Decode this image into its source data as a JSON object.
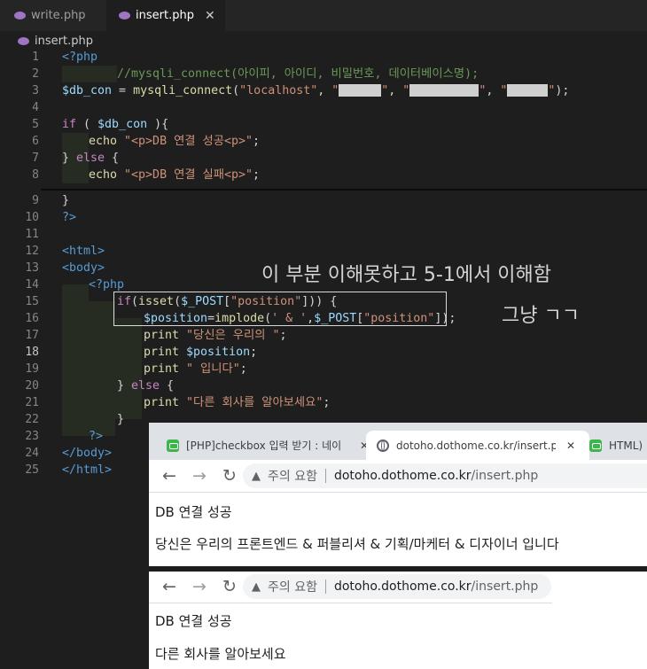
{
  "editor": {
    "tabs": [
      {
        "label": "write.php"
      },
      {
        "label": "insert.php"
      }
    ],
    "close_glyph": "✕",
    "breadcrumb": "insert.php",
    "file_icon": "php-elephant-icon",
    "lines": [
      {
        "n": "1"
      },
      {
        "n": "2"
      },
      {
        "n": "3"
      },
      {
        "n": "4"
      },
      {
        "n": "5"
      },
      {
        "n": "6"
      },
      {
        "n": "7"
      },
      {
        "n": "8"
      },
      {
        "n": "9"
      },
      {
        "n": "10"
      },
      {
        "n": "11"
      },
      {
        "n": "12"
      },
      {
        "n": "13"
      },
      {
        "n": "14"
      },
      {
        "n": "15"
      },
      {
        "n": "16"
      },
      {
        "n": "17"
      },
      {
        "n": "18"
      },
      {
        "n": "19"
      },
      {
        "n": "20"
      },
      {
        "n": "21"
      },
      {
        "n": "22"
      },
      {
        "n": "23"
      },
      {
        "n": "24"
      },
      {
        "n": "25"
      }
    ],
    "code": {
      "l1": "<?php",
      "l2": "//mysqli_connect(아이피, 아이디, 비밀번호, 데이터베이스명);",
      "l3_var": "$db_con",
      "l3_eq": " = ",
      "l3_fn": "mysqli_connect",
      "l3_open": "(",
      "l3_s1": "\"localhost\"",
      "l3_comma1": ", ",
      "l3_s2a": "\"",
      "l3_s2b": "\"",
      "l3_comma2": ", ",
      "l3_s3a": "\"",
      "l3_s3b": "\"",
      "l3_comma3": ", ",
      "l3_s4a": "\"",
      "l3_s4b": "\"",
      "l3_close": ");",
      "l5_if": "if",
      "l5_p1": " ( ",
      "l5_var": "$db_con",
      "l5_p2": " ){",
      "l6_echo": "echo",
      "l6_str": " \"<p>DB 연결 성공<p>\"",
      "l6_semi": ";",
      "l7_brace": "} ",
      "l7_else": "else",
      "l7_open": " {",
      "l8_echo": "echo",
      "l8_str": " \"<p>DB 연결 실패<p>\"",
      "l8_semi": ";",
      "l9": "}",
      "l10": "?>",
      "l12": "<html>",
      "l13": "<body>",
      "l14": "<?php",
      "l15_if": "if",
      "l15_p": "(",
      "l15_fn": "isset",
      "l15_p2": "(",
      "l15_var": "$_POST",
      "l15_b1": "[",
      "l15_s": "\"position\"",
      "l15_b2": "])) {",
      "l16_var": "$position",
      "l16_eq": "=",
      "l16_fn": "implode",
      "l16_p": "(",
      "l16_s": "' & '",
      "l16_c": ",",
      "l16_var2": "$_POST",
      "l16_b1": "[",
      "l16_s2": "\"position\"",
      "l16_b2": "]);",
      "l17_print": "print",
      "l17_str": " \"당신은 우리의 \"",
      "l17_semi": ";",
      "l18_print": "print",
      "l18_var": " $position",
      "l18_semi": ";",
      "l19_print": "print",
      "l19_str": " \" 입니다\"",
      "l19_semi": ";",
      "l20_brace": "} ",
      "l20_else": "else",
      "l20_open": " {",
      "l21_print": "print",
      "l21_str": " \"다른 회사를 알아보세요\"",
      "l21_semi": ";",
      "l22": "}",
      "l23": "?>",
      "l24": "</body>",
      "l25": "</html>"
    }
  },
  "annotation": {
    "line1": "이 부분 이해못하고 5-1에서 이해함",
    "line2": "그냥 ㄱㄱ"
  },
  "browser1": {
    "tabs": [
      {
        "label": "[PHP]checkbox 입력 받기 : 네이",
        "icon": "naver-blog-icon"
      },
      {
        "label": "dotoho.dothome.co.kr/insert.php",
        "icon": "globe-icon"
      },
      {
        "label": "HTML) <",
        "icon": "naver-blog-icon"
      }
    ],
    "close_glyph": "✕",
    "warning": "주의 요함",
    "url_host": "dotoho.dothome.co.kr",
    "url_path": "/insert.php",
    "page": {
      "line1": "DB 연결 성공",
      "line2": "당신은 우리의 프론트엔드 & 퍼블리셔 & 기획/마케터 & 디자이너 입니다"
    }
  },
  "browser2": {
    "warning": "주의 요함",
    "url_host": "dotoho.dothome.co.kr",
    "url_path": "/insert.php",
    "page": {
      "line1": "DB 연결 성공",
      "line2": "다른 회사를 알아보세요"
    }
  },
  "colors": {
    "editor_bg": "#1e1e1e",
    "keyword": "#569cd6",
    "control": "#c586c0",
    "string": "#ce9178",
    "variable": "#9cdcfe",
    "function": "#dcdcaa",
    "comment": "#6a9955"
  }
}
